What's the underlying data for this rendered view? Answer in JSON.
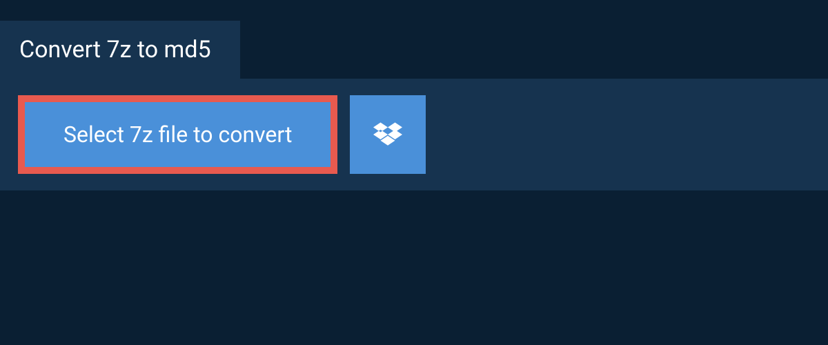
{
  "header": {
    "title": "Convert 7z to md5"
  },
  "actions": {
    "select_label": "Select 7z file to convert",
    "dropbox_icon_name": "dropbox-icon"
  },
  "colors": {
    "background": "#0a1f33",
    "panel": "#16334f",
    "button": "#4a90d9",
    "highlight_border": "#e85a4f",
    "text": "#ffffff"
  }
}
